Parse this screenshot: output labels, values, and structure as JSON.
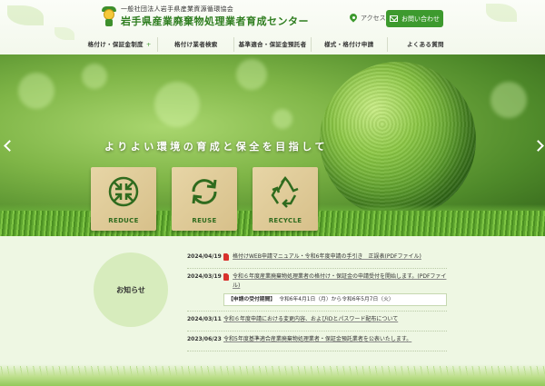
{
  "header": {
    "org_small": "一般社団法人岩手県産業資源循環協会",
    "org_main": "岩手県産業廃棄物処理業者育成センター",
    "access_label": "アクセス",
    "contact_label": "お問い合わせ"
  },
  "nav": {
    "items": [
      {
        "label": "格付け・保証金制度",
        "has_submenu": true
      },
      {
        "label": "格付け業者検索"
      },
      {
        "label": "基準適合・保証金預託者"
      },
      {
        "label": "様式・格付け申請"
      },
      {
        "label": "よくある質問"
      }
    ],
    "submenu_marker": "+"
  },
  "hero": {
    "tagline": "よりよい環境の育成と保全を目指して",
    "blocks": [
      "REDUCE",
      "REUSE",
      "RECYCLE"
    ]
  },
  "news": {
    "heading": "お知らせ",
    "items": [
      {
        "date": "2024/04/19",
        "pdf": true,
        "text": "格付けWEB申請マニュアル・令和6年度申請の手引き　正誤表(PDFファイル)"
      },
      {
        "date": "2024/03/19",
        "pdf": true,
        "text": "令和６年度産業廃棄物処理業者の格付け・保証金の申請受付を開始します。(PDFファイル)",
        "period_label": "【申請の受付期間】",
        "period_value": "令和6年4月1日（月）から令和6年5月7日（火）"
      },
      {
        "date": "2024/03/11",
        "pdf": false,
        "text": "令和６年度申請における変更内容、およびIDとパスワード配布について"
      },
      {
        "date": "2023/06/23",
        "pdf": false,
        "text": "令和5年度基準適合産業廃棄物処理業者・保証金預託業者を公表いたします。"
      }
    ]
  },
  "colors": {
    "brand_green": "#3d9a2e",
    "title_green": "#2e7d1f",
    "pdf_red": "#d8322d"
  }
}
